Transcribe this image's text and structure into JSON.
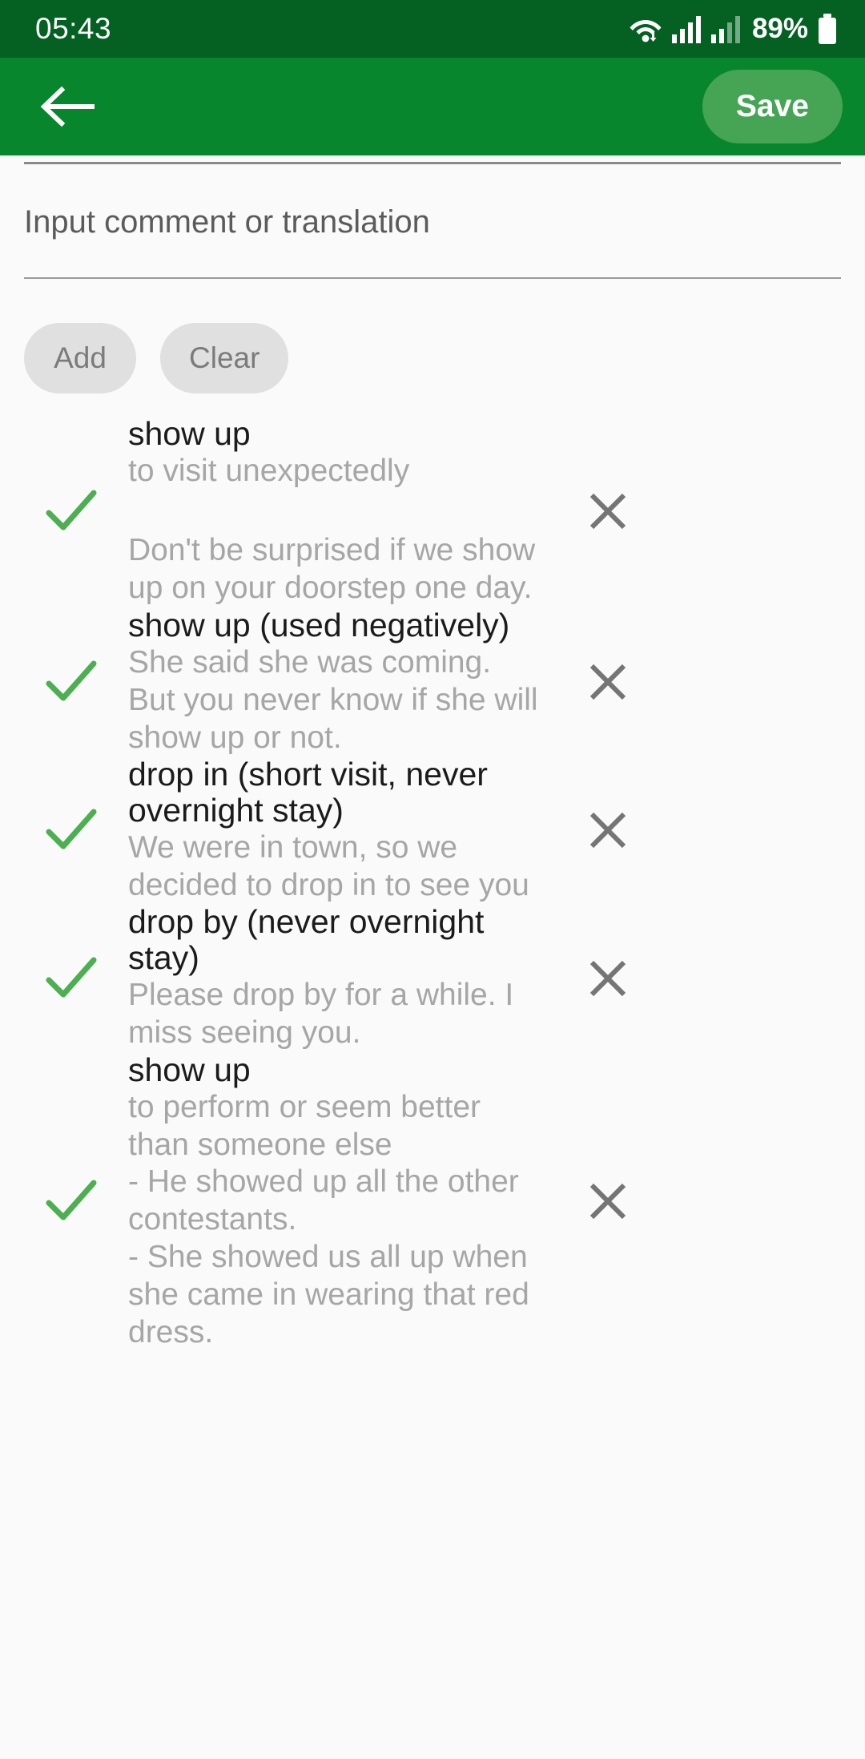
{
  "status_bar": {
    "clock": "05:43",
    "battery_percent": "89%",
    "icons": [
      "wifi-icon",
      "signal-bars-icon",
      "signal-bars-secondary-icon",
      "battery-icon"
    ]
  },
  "app_bar": {
    "back_icon": "arrow-left-icon",
    "save_label": "Save",
    "background_color": "#08862e",
    "save_button_color": "#46a555"
  },
  "editor": {
    "placeholder": "Input comment or translation",
    "value": ""
  },
  "actions": {
    "add_label": "Add",
    "clear_label": "Clear"
  },
  "list": {
    "check_color": "#4caf50",
    "delete_color": "#757575",
    "items": [
      {
        "title": "show up",
        "definition": "to visit unexpectedly",
        "example": "Don't be surprised if we show up on your doorstep one day.",
        "checked": true,
        "spaced_example": true
      },
      {
        "title": "show up (used negatively)",
        "definition": "She said she was coming. But you never know if she will show up or not.",
        "example": "",
        "checked": true,
        "spaced_example": false
      },
      {
        "title": "drop in (short visit, never overnight stay)",
        "definition": "We were in town,  so we decided to drop in to see you",
        "example": "",
        "checked": true,
        "spaced_example": false
      },
      {
        "title": "drop by (never overnight stay)",
        "definition": "Please drop by for a while. I miss seeing you.",
        "example": "",
        "checked": true,
        "spaced_example": false
      },
      {
        "title": "show up",
        "definition": "to perform or seem better than someone else",
        "example": "- He showed up all the other contestants.\n- She showed us all up when she came in wearing that red dress.",
        "checked": true,
        "spaced_example": false
      }
    ]
  }
}
